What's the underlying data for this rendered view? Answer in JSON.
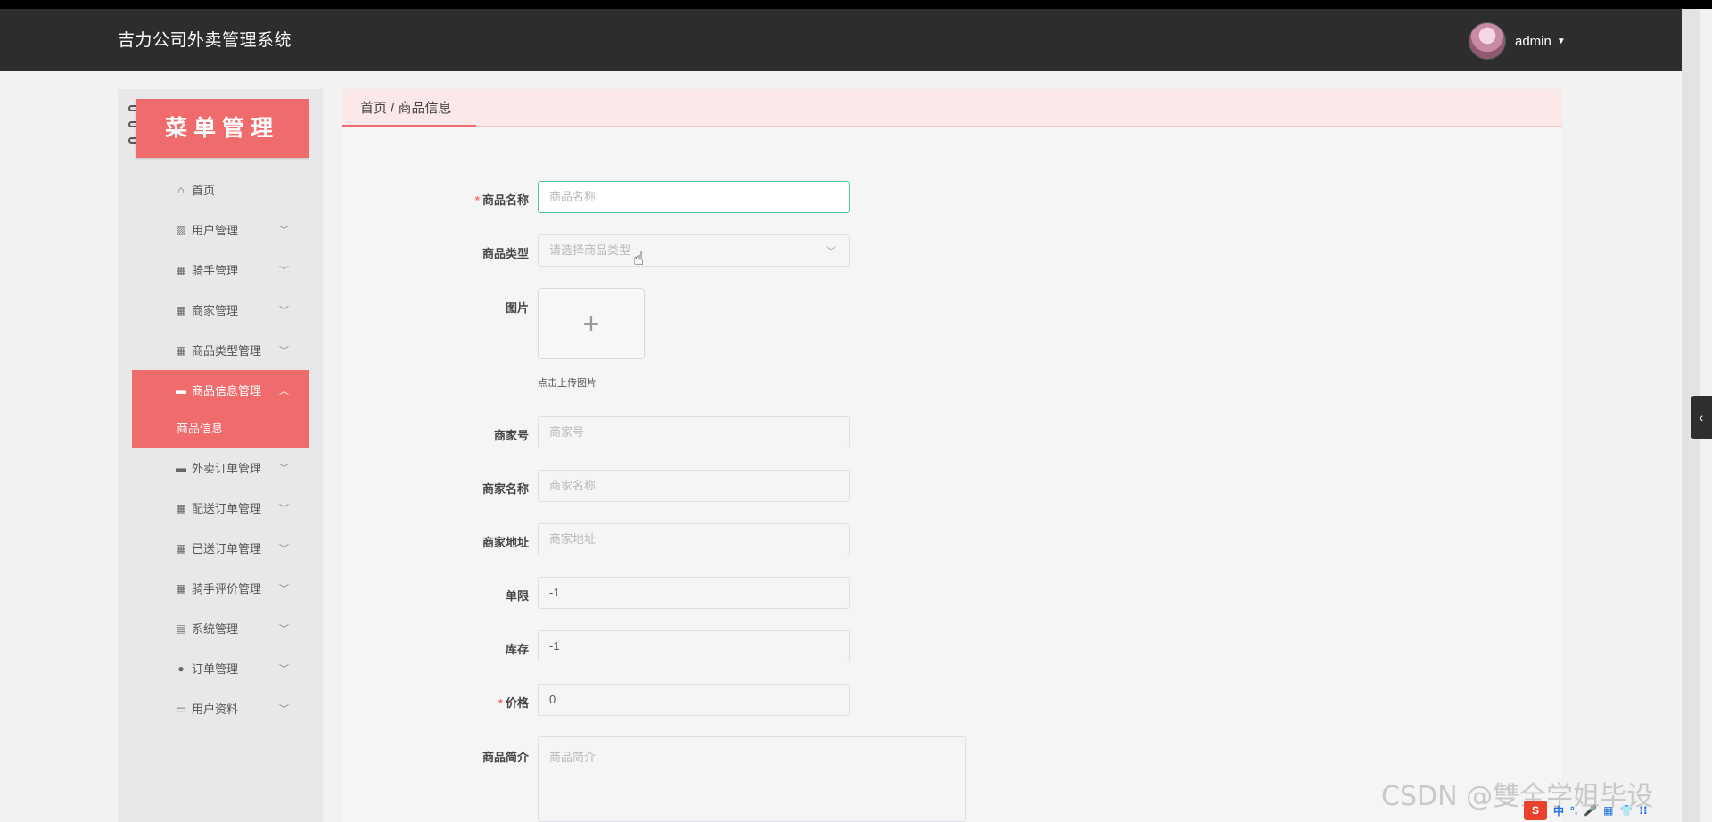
{
  "app": {
    "title": "吉力公司外卖管理系统",
    "user_name": "admin"
  },
  "sidebar": {
    "banner": "菜单管理",
    "items": [
      {
        "label": "首页",
        "icon": "home-icon",
        "glyph": "⌂",
        "has_arrow": false
      },
      {
        "label": "用户管理",
        "icon": "chart-icon",
        "glyph": "▨",
        "has_arrow": true
      },
      {
        "label": "骑手管理",
        "icon": "grid-icon",
        "glyph": "▦",
        "has_arrow": true
      },
      {
        "label": "商家管理",
        "icon": "grid-icon",
        "glyph": "▦",
        "has_arrow": true
      },
      {
        "label": "商品类型管理",
        "icon": "grid-icon",
        "glyph": "▦",
        "has_arrow": true
      },
      {
        "label": "商品信息管理",
        "icon": "document-icon",
        "glyph": "▬",
        "has_arrow": true,
        "active": true
      },
      {
        "label": "外卖订单管理",
        "icon": "monitor-icon",
        "glyph": "▬",
        "has_arrow": true
      },
      {
        "label": "配送订单管理",
        "icon": "grid-icon",
        "glyph": "▦",
        "has_arrow": true
      },
      {
        "label": "已送订单管理",
        "icon": "grid-icon",
        "glyph": "▦",
        "has_arrow": true
      },
      {
        "label": "骑手评价管理",
        "icon": "grid-icon",
        "glyph": "▦",
        "has_arrow": true
      },
      {
        "label": "系统管理",
        "icon": "clipboard-icon",
        "glyph": "▤",
        "has_arrow": true
      },
      {
        "label": "订单管理",
        "icon": "location-icon",
        "glyph": "●",
        "has_arrow": true
      },
      {
        "label": "用户资料",
        "icon": "card-icon",
        "glyph": "▭",
        "has_arrow": true
      }
    ],
    "submenu_active": "商品信息"
  },
  "breadcrumb": {
    "text": "首页 / 商品信息"
  },
  "form": {
    "name": {
      "label": "商品名称",
      "required": true,
      "placeholder": "商品名称"
    },
    "type": {
      "label": "商品类型",
      "placeholder": "请选择商品类型"
    },
    "image": {
      "label": "图片",
      "hint": "点击上传图片"
    },
    "merchant_no": {
      "label": "商家号",
      "placeholder": "商家号"
    },
    "merchant_name": {
      "label": "商家名称",
      "placeholder": "商家名称"
    },
    "merchant_address": {
      "label": "商家地址",
      "placeholder": "商家地址"
    },
    "single_limit": {
      "label": "单限",
      "value": "-1"
    },
    "stock": {
      "label": "库存",
      "value": "-1"
    },
    "price": {
      "label": "价格",
      "required": true,
      "value": "0"
    },
    "intro": {
      "label": "商品简介",
      "placeholder": "商品简介"
    }
  },
  "overlay": {
    "watermark": "CSDN @雙全学姐毕设",
    "ime": [
      "中",
      "°,",
      "🎤",
      "▦",
      "👕",
      "⁝⁝"
    ]
  },
  "colors": {
    "accent": "#f06b6b",
    "topbar": "#2d2d2d",
    "focus": "#4cc3a3",
    "required": "#f56c6c"
  }
}
